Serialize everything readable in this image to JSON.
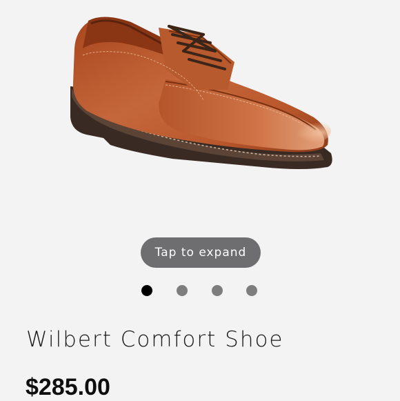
{
  "gallery": {
    "image_alt": "Wilbert Comfort Shoe",
    "expand_label": "Tap to expand",
    "dot_count": 4,
    "active_index": 0
  },
  "product": {
    "name": "Wilbert Comfort Shoe",
    "price": "$285.00"
  },
  "colors": {
    "leather": "#b4552a",
    "sole": "#3a2a24",
    "pill": "#6e6e71",
    "dot_active": "#000000",
    "dot_inactive": "#7d7d7d"
  }
}
